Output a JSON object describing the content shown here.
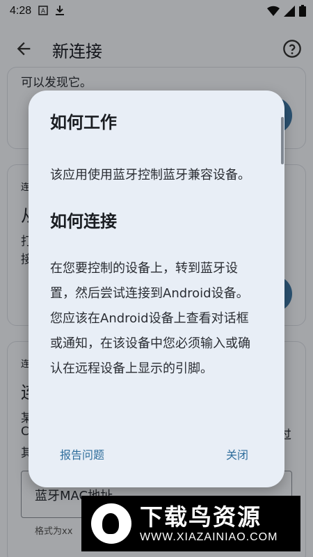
{
  "status_bar": {
    "time": "4:28"
  },
  "app_bar": {
    "title": "新连接"
  },
  "background": {
    "card1_text": "可以发现它。",
    "card2_label": "连",
    "card2_title": "从",
    "card2_line1": "打",
    "card2_line2": "接",
    "card3_label": "连",
    "card3_title": "连",
    "card3_line1": "某",
    "card3_line2": "C",
    "card3_line3": "其",
    "card3_right": "过",
    "field_value": "蓝牙MAC地址",
    "field_helper": "格式为xx"
  },
  "dialog": {
    "heading1": "如何工作",
    "para1": "该应用使用蓝牙控制蓝牙兼容设备。",
    "heading2": "如何连接",
    "para2": "在您要控制的设备上，转到蓝牙设置，然后尝试连接到Android设备。您应该在Android设备上查看对话框或通知，在该设备中您必须输入或确认在远程设备上显示的引脚。",
    "report_label": "报告问题",
    "close_label": "关闭"
  },
  "watermark": {
    "title": "下载鸟资源",
    "url": "WWW.XIAZAINIAO.COM"
  },
  "colors": {
    "accent": "#2f6e9c",
    "dialog_bg": "#e8eef6",
    "page_bg": "#f5f8fd"
  }
}
